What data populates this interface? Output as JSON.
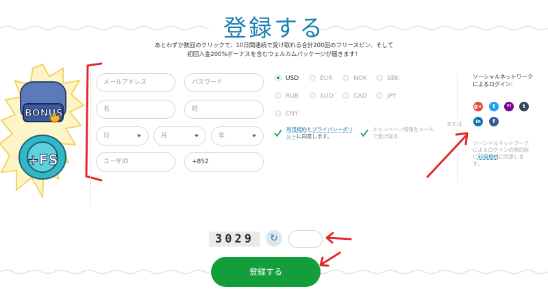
{
  "header": {
    "title": "登録する",
    "subtitle_line1": "あとわずか数回のクリックで、10日間連続で受け取れる合計200回のフリースピン、そして",
    "subtitle_line2": "初回入金200%ボーナスを含むウェルカムパッケージが届きます！"
  },
  "promo": {
    "badge1": "BONUS",
    "badge2": "+FS"
  },
  "form": {
    "email_placeholder": "メールアドレス",
    "password_placeholder": "パスワード",
    "first_name_placeholder": "名",
    "last_name_placeholder": "姓",
    "day_label": "日",
    "month_label": "月",
    "year_label": "年",
    "userid_placeholder": "ユーザID",
    "phone_value": "+852"
  },
  "currencies": {
    "selected": "USD",
    "options": [
      "USD",
      "EUR",
      "NOK",
      "SEK",
      "RUB",
      "AUD",
      "CAD",
      "JPY",
      "CNY"
    ]
  },
  "terms": {
    "link1": "利用規約",
    "mid": "と",
    "link2": "プライバシーポリシー",
    "suffix": "に同意します。"
  },
  "campaign": {
    "text": "キャンペーン情報をメールで受け取る"
  },
  "or_text": "または",
  "social": {
    "heading": "ソーシャルネットワークによるログイン:",
    "icons": [
      "google-plus-icon",
      "twitter-icon",
      "yahoo-icon",
      "tumblr-icon",
      "linkedin-icon",
      "facebook-icon"
    ],
    "glyphs": [
      "g+",
      "t",
      "Y!",
      "t",
      "in",
      "f"
    ],
    "colors": [
      "#dd4b39",
      "#1da1f2",
      "#7b0099",
      "#35465c",
      "#0e76a8",
      "#3b5998"
    ],
    "note_prefix": "ソーシャルネットワークによるログインの際同時に",
    "note_link": "利用規約",
    "note_suffix": "に同意します。"
  },
  "captcha": {
    "text": "3029"
  },
  "submit": {
    "label": "登録する"
  },
  "colors": {
    "accent": "#1d7fb1",
    "button": "#139e3c",
    "annotation": "#e0282b"
  }
}
